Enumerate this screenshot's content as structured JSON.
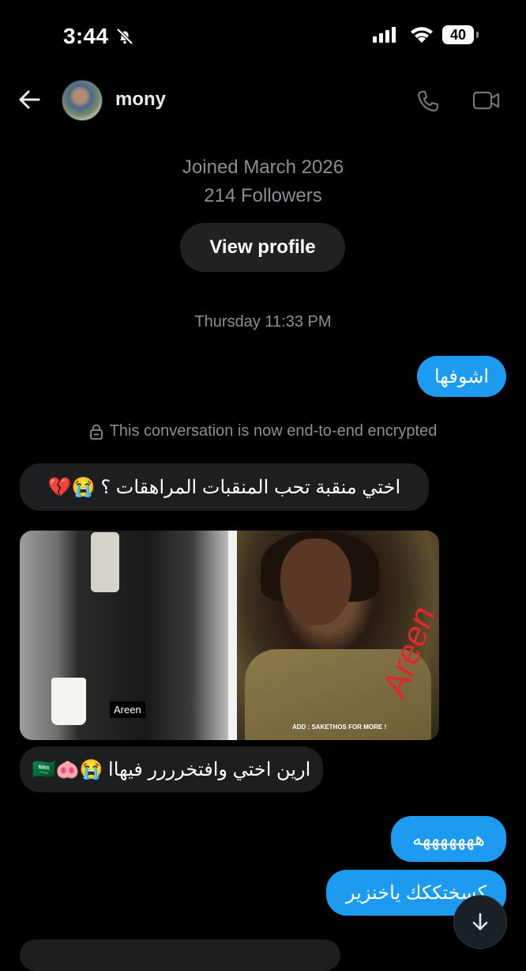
{
  "status_bar": {
    "time": "3:44",
    "battery": "40"
  },
  "header": {
    "username": "mony"
  },
  "profile": {
    "joined": "Joined March 2026",
    "followers": "214 Followers",
    "view_profile_label": "View profile"
  },
  "conversation": {
    "day_stamp": "Thursday 11:33 PM",
    "encrypted_notice": "This conversation is now end-to-end encrypted",
    "messages": [
      {
        "direction": "outgoing",
        "text": "اشوفها"
      },
      {
        "direction": "incoming",
        "text": "اختي منقبة تحب المنقبات المراهقات ؟ 😭💔"
      },
      {
        "direction": "incoming",
        "type": "image",
        "caption_left": "Areen",
        "caption_right": "ADD : SAKETHOS FOR MORE !",
        "signature": "Areen"
      },
      {
        "direction": "incoming",
        "text": "ارين اختي وافتخرررر فيهاا 😭🐽🇸🇦"
      },
      {
        "direction": "outgoing",
        "text": "هههههههه"
      },
      {
        "direction": "outgoing",
        "text": "كسختككك ياخنزير"
      }
    ]
  },
  "colors": {
    "accent": "#1d9bf0",
    "background": "#000000",
    "incoming_bubble": "#1c1e20"
  },
  "icons": [
    "bell-slash-icon",
    "signal-icon",
    "wifi-icon",
    "back-arrow-icon",
    "phone-icon",
    "video-icon",
    "lock-icon",
    "arrow-down-icon"
  ]
}
